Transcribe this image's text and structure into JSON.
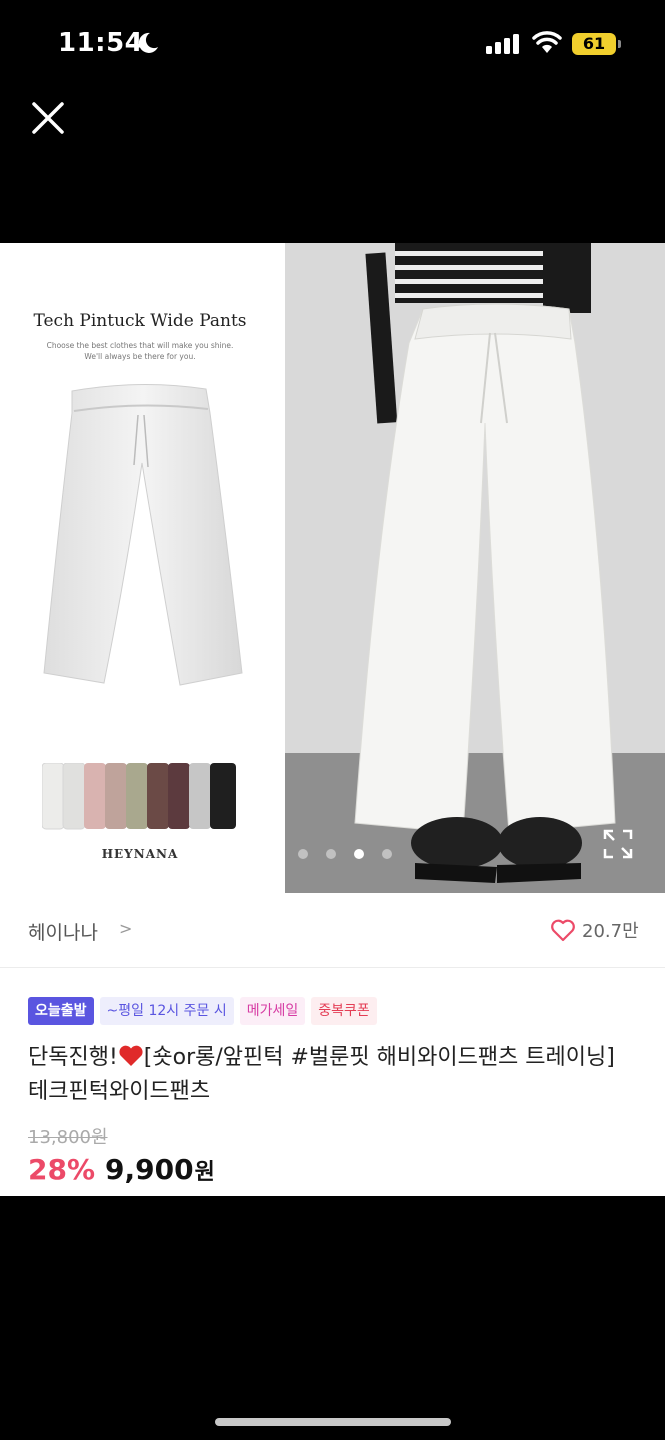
{
  "status_bar": {
    "time": "11:54",
    "battery": "61",
    "icons": [
      "moon-icon",
      "signal-icon",
      "wifi-icon",
      "battery-icon"
    ]
  },
  "header": {
    "close_icon": "close-icon"
  },
  "gallery": {
    "left_title": "Tech Pintuck Wide Pants",
    "left_subtitle_1": "Choose the best clothes that will make you shine.",
    "left_subtitle_2": "We'll always be there for you.",
    "brand_logo": "HEYNANA",
    "active_image": 3,
    "image_count": 4,
    "expand_icon": "expand-icon",
    "color_swatches": [
      "#ececea",
      "#e0e0de",
      "#d9b3b0",
      "#bfa39b",
      "#a9a88e",
      "#6b4a46",
      "#5c3a3e",
      "#c6c6c6",
      "#1f1f1f"
    ]
  },
  "store": {
    "name": "헤이나나",
    "arrow": ">",
    "likes": "20.7만"
  },
  "badges": {
    "today": "오늘출발",
    "time": "~평일 12시 주문 시",
    "mega": "메가세일",
    "coupon": "중복쿠폰"
  },
  "product": {
    "title_prefix": "단독진행!",
    "title_rest": "[숏or롱/앞핀턱 #벌룬핏 해비와이드팬츠 트레이닝] 테크핀턱와이드팬츠",
    "original_price": "13,800원",
    "discount": "28%",
    "price": "9,900",
    "currency": "원"
  },
  "colors": {
    "accent_purple": "#5a55e0",
    "discount_red": "#ec4a68",
    "heart": "#ec4a68",
    "battery_yellow": "#f1cf2d"
  }
}
